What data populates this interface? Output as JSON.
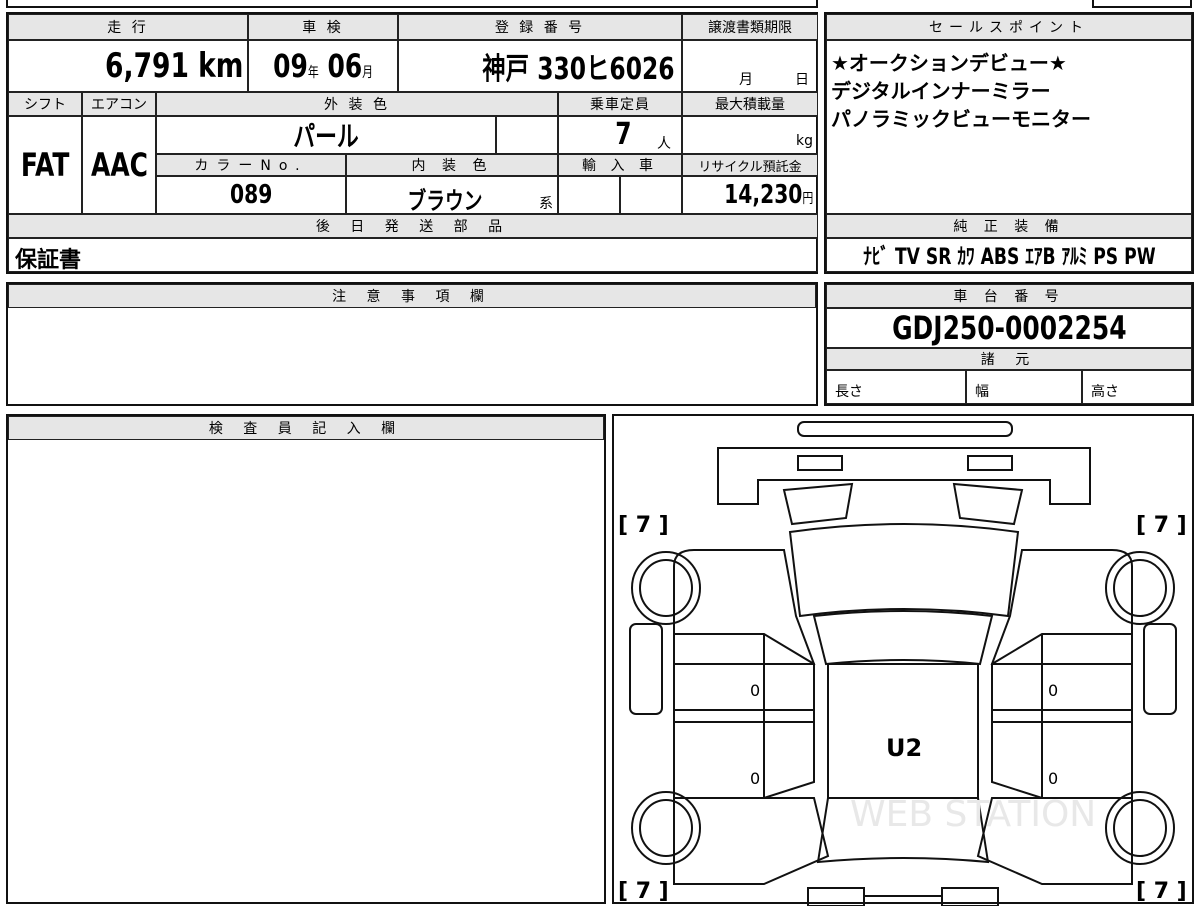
{
  "headers": {
    "mileage": "走 行",
    "inspection": "車 検",
    "registration": "登 録 番 号",
    "transfer_deadline": "譲渡書類期限",
    "sales_point": "セールスポイント",
    "shift": "シフト",
    "aircon": "エアコン",
    "exterior_color": "外 装 色",
    "capacity": "乗車定員",
    "max_load": "最大積載量",
    "color_no": "カラーNo.",
    "interior_color": "内 装 色",
    "import": "輸 入 車",
    "recycle": "リサイクル預託金",
    "later_parts": "後 日 発 送 部 品",
    "equipment": "純 正 装 備",
    "caution": "注 意 事 項 欄",
    "chassis": "車 台 番 号",
    "specs": "諸 元",
    "inspector": "検 査 員 記 入 欄"
  },
  "values": {
    "mileage": "6,791",
    "mileage_unit": "km",
    "inspection_year": "09",
    "inspection_year_unit": "年",
    "inspection_month": "06",
    "inspection_month_unit": "月",
    "registration": "神戸 330ヒ6026",
    "transfer_month_unit": "月",
    "transfer_day_unit": "日",
    "shift": "FAT",
    "aircon": "AAC",
    "exterior_color": "パール",
    "capacity": "7",
    "capacity_unit": "人",
    "max_load_unit": "kg",
    "color_no": "089",
    "interior_color": "ブラウン",
    "interior_suffix": "系",
    "recycle": "14,230",
    "recycle_unit": "円",
    "later_parts": "保証書",
    "equipment": "ﾅﾋﾞ TV SR ｶﾜ ABS ｴｱB ｱﾙﾐ PS PW",
    "chassis": "GDJ250-0002254",
    "spec_length": "長さ",
    "spec_width": "幅",
    "spec_height": "高さ"
  },
  "sales_points": [
    "★オークションデビュー★",
    "デジタルインナーミラー",
    "パノラミックビューモニター"
  ],
  "diagram": {
    "tread_fl": "[ 7 ]",
    "tread_fr": "[ 7 ]",
    "tread_rl": "[ 7 ]",
    "tread_rr": "[ 7 ]",
    "door_left_front": "0",
    "door_right_front": "0",
    "door_left_rear": "0",
    "door_right_rear": "0",
    "roof_grade": "U2",
    "watermark": "WEB STATION"
  }
}
